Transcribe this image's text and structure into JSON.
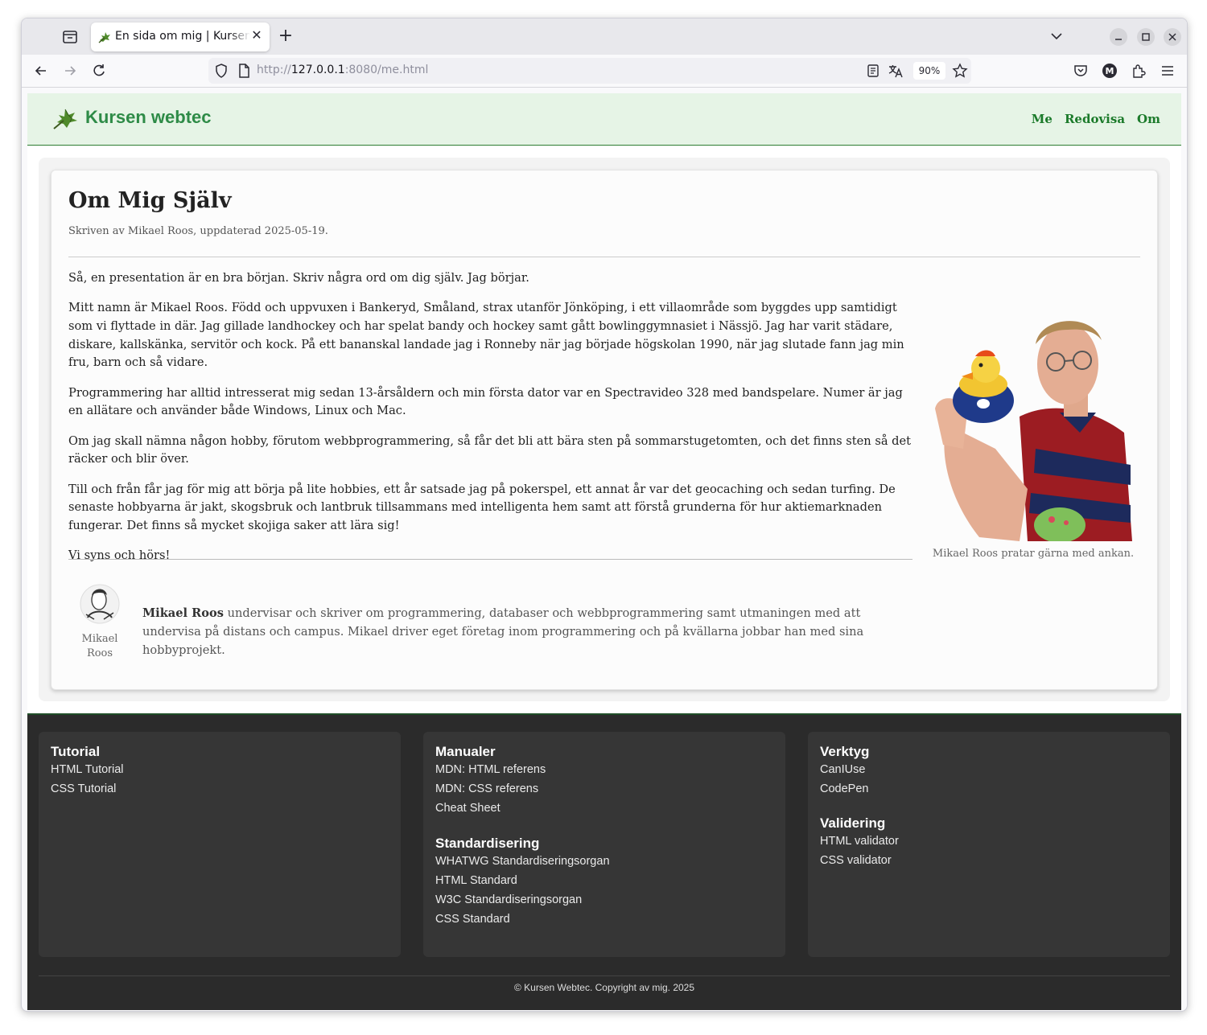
{
  "browser": {
    "tab_title": "En sida om mig | Kursen webtec",
    "tab_close": "✕",
    "new_tab": "+",
    "url_scheme": "http://",
    "url_host": "127.0.0.1",
    "url_rest": ":8080/me.html",
    "zoom": "90%"
  },
  "site": {
    "title": "Kursen webtec",
    "nav": [
      "Me",
      "Redovisa",
      "Om"
    ]
  },
  "article": {
    "heading": "Om Mig Själv",
    "byline": "Skriven av Mikael Roos, uppdaterad 2025-05-19.",
    "paragraphs": [
      "Så, en presentation är en bra början. Skriv några ord om dig själv. Jag börjar.",
      "Mitt namn är Mikael Roos. Född och uppvuxen i Bankeryd, Småland, strax utanför Jönköping, i ett villaområde som byggdes upp samtidigt som vi flyttade in där. Jag gillade landhockey och har spelat bandy och hockey samt gått bowlinggymnasiet i Nässjö. Jag har varit städare, diskare, kallskänka, servitör och kock. På ett bananskal landade jag i Ronneby när jag började högskolan 1990, när jag slutade fann jag min fru, barn och så vidare.",
      "Programmering har alltid intresserat mig sedan 13-årsåldern och min första dator var en Spectravideo 328 med bandspelare. Numer är jag en allätare och använder både Windows, Linux och Mac.",
      "Om jag skall nämna någon hobby, förutom webbprogrammering, så får det bli att bära sten på sommarstugetomten, och det finns sten så det räcker och blir över.",
      "Till och från får jag för mig att börja på lite hobbies, ett år satsade jag på pokerspel, ett annat år var det geocaching och sedan turfing. De senaste hobbyarna är jakt, skogsbruk och lantbruk tillsammans med intelligenta hem samt att förstå grunderna för hur aktiemarknaden fungerar. Det finns så mycket skojiga saker att lära sig!",
      "Vi syns och hörs!"
    ],
    "photo_caption": "Mikael Roos pratar gärna med ankan.",
    "author_name_first": "Mikael",
    "author_name_last": "Roos",
    "author_bio_name": "Mikael Roos",
    "author_bio_text": " undervisar och skriver om programmering, databaser och webbprogrammering samt utmaningen med att undervisa på distans och campus. Mikael driver eget företag inom programmering och på kvällarna jobbar han med sina hobbyprojekt."
  },
  "footer": {
    "tutorial": {
      "heading": "Tutorial",
      "links": [
        "HTML Tutorial",
        "CSS Tutorial"
      ]
    },
    "manualer": {
      "heading": "Manualer",
      "links": [
        "MDN: HTML referens",
        "MDN: CSS referens",
        "Cheat Sheet"
      ]
    },
    "standardisering": {
      "heading": "Standardisering",
      "links": [
        "WHATWG Standardiseringsorgan",
        "HTML Standard",
        "W3C Standardiseringsorgan",
        "CSS Standard"
      ]
    },
    "verktyg": {
      "heading": "Verktyg",
      "links": [
        "CanIUse",
        "CodePen"
      ]
    },
    "validering": {
      "heading": "Validering",
      "links": [
        "HTML validator",
        "CSS validator"
      ]
    },
    "copyright": "© Kursen Webtec. Copyright av mig. 2025"
  },
  "colors": {
    "accent": "#2e8b47",
    "header_bg": "#e6f4e6",
    "footer_bg": "#2b2b2b"
  }
}
